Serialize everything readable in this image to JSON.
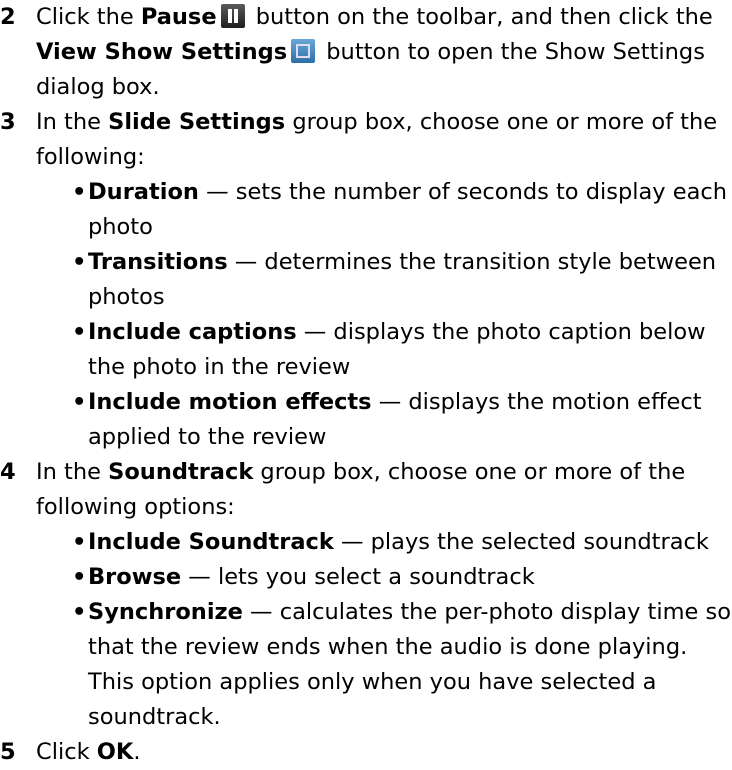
{
  "steps": [
    {
      "num": "2",
      "a": "Click the ",
      "pause": "Pause",
      "b": " button on the toolbar, and then click the ",
      "view": "View Show Settings",
      "c": " button to open the Show Settings dialog box.",
      "icons": [
        "pause-icon",
        "show-settings-icon"
      ]
    },
    {
      "num": "3",
      "a": "In the ",
      "group": "Slide Settings",
      "b": " group box, choose one or more of the following:",
      "bullets": [
        {
          "term": "Duration",
          "desc": " — sets the number of seconds to display each photo"
        },
        {
          "term": "Transitions",
          "desc": " — determines the transition style between photos"
        },
        {
          "term": "Include captions",
          "desc": " — displays the photo caption below the photo in the review"
        },
        {
          "term": "Include motion effects",
          "desc": " — displays the motion effect applied to the review"
        }
      ]
    },
    {
      "num": "4",
      "a": "In the ",
      "group": "Soundtrack",
      "b": " group box, choose one or more of the following options:",
      "bullets": [
        {
          "term": "Include Soundtrack",
          "desc": " — plays the selected soundtrack"
        },
        {
          "term": "Browse",
          "desc": " — lets you select a soundtrack"
        },
        {
          "term": "Synchronize",
          "desc": " — calculates the per-photo display time so that the review ends when the audio is done playing. This option applies only when you have selected a soundtrack."
        }
      ]
    },
    {
      "num": "5",
      "a": "Click ",
      "ok": "OK",
      "b": "."
    }
  ]
}
